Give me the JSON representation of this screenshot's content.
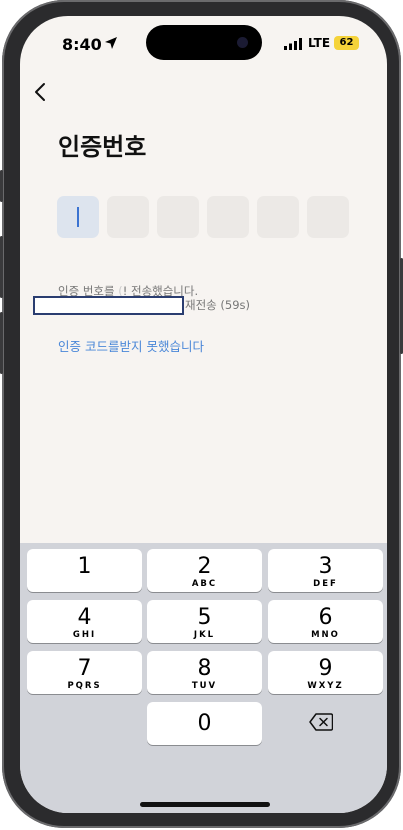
{
  "status": {
    "time": "8:40",
    "network": "LTE",
    "battery": "62"
  },
  "page": {
    "title": "인증번호",
    "code_boxes": 6
  },
  "info": {
    "prefix": "인증 번호를 ",
    "masked": "(",
    "suffix": "! 전송했습니다.",
    "resend": "재전송 (59s)"
  },
  "link": {
    "not_received": "인증 코드를받지 못했습니다"
  },
  "keypad": {
    "keys": [
      {
        "num": "1",
        "sub": ""
      },
      {
        "num": "2",
        "sub": "ABC"
      },
      {
        "num": "3",
        "sub": "DEF"
      },
      {
        "num": "4",
        "sub": "GHI"
      },
      {
        "num": "5",
        "sub": "JKL"
      },
      {
        "num": "6",
        "sub": "MNO"
      },
      {
        "num": "7",
        "sub": "PQRS"
      },
      {
        "num": "8",
        "sub": "TUV"
      },
      {
        "num": "9",
        "sub": "WXYZ"
      },
      {
        "num": "0",
        "sub": ""
      }
    ],
    "delete_icon": "backspace-icon"
  },
  "colors": {
    "accent": "#4a87d8",
    "cursor": "#3b73d1",
    "battery": "#f5d33a"
  }
}
